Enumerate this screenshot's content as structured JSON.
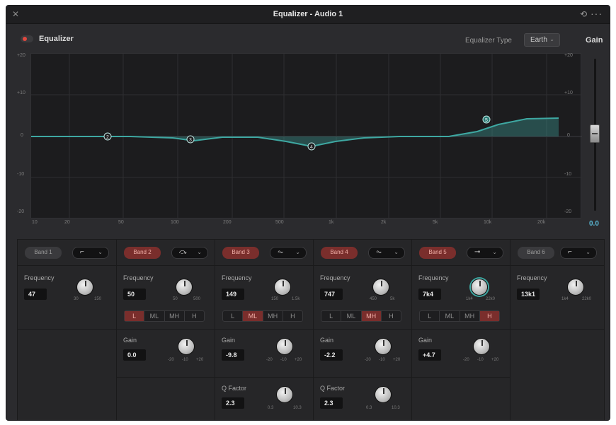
{
  "window": {
    "title": "Equalizer - Audio 1"
  },
  "titlebar": {
    "close_icon": "close-icon",
    "reset_icon": "reset-icon",
    "more_icon": "more-icon",
    "close_glyph": "✕",
    "reset_glyph": "⟲",
    "more_glyph": "···"
  },
  "header": {
    "equalizer_label": "Equalizer",
    "equalizer_enabled": true,
    "type_label": "Equalizer Type",
    "type_value": "Earth",
    "gain_title": "Gain"
  },
  "graph": {
    "left_ticks": [
      "+20",
      "+10",
      "0",
      "-10",
      "-20"
    ],
    "right_ticks": [
      "+20",
      "+10",
      "0",
      "-10",
      "-20"
    ],
    "x_ticks": [
      "10",
      "20",
      "50",
      "100",
      "200",
      "500",
      "1k",
      "2k",
      "5k",
      "10k",
      "20k"
    ],
    "curve_color": "#3ea8a2",
    "nodes": [
      "2",
      "3",
      "4",
      "5"
    ]
  },
  "gain": {
    "value": "0.0",
    "fader_level": 0.5
  },
  "bands": [
    {
      "label": "Band 1",
      "active": false,
      "shape_glyph": "⌐",
      "frequency_label": "Frequency",
      "frequency": "47",
      "freq_min": "30",
      "freq_max": "150"
    },
    {
      "label": "Band 2",
      "active": true,
      "shape_glyph": "⤼",
      "frequency_label": "Frequency",
      "frequency": "50",
      "freq_min": "50",
      "freq_max": "500",
      "ranges": [
        "L",
        "ML",
        "MH",
        "H"
      ],
      "range_selected": "L",
      "gain_label": "Gain",
      "gain": "0.0",
      "gain_min": "-20",
      "gain_mid": "-10",
      "gain_max": "+20"
    },
    {
      "label": "Band 3",
      "active": true,
      "shape_glyph": "⏦",
      "frequency_label": "Frequency",
      "frequency": "149",
      "freq_min": "150",
      "freq_max": "1.5k",
      "ranges": [
        "L",
        "ML",
        "MH",
        "H"
      ],
      "range_selected": "ML",
      "gain_label": "Gain",
      "gain": "-9.8",
      "gain_min": "-20",
      "gain_mid": "-10",
      "gain_max": "+20",
      "q_label": "Q Factor",
      "q": "2.3",
      "q_min": "0.3",
      "q_max": "10.3"
    },
    {
      "label": "Band 4",
      "active": true,
      "shape_glyph": "⏦",
      "frequency_label": "Frequency",
      "frequency": "747",
      "freq_min": "450",
      "freq_max": "5k",
      "ranges": [
        "L",
        "ML",
        "MH",
        "H"
      ],
      "range_selected": "MH",
      "gain_label": "Gain",
      "gain": "-2.2",
      "gain_min": "-20",
      "gain_mid": "-10",
      "gain_max": "+20",
      "q_label": "Q Factor",
      "q": "2.3",
      "q_min": "0.3",
      "q_max": "10.3"
    },
    {
      "label": "Band 5",
      "active": true,
      "shape_glyph": "⊸",
      "frequency_label": "Frequency",
      "frequency": "7k4",
      "freq_min": "1k4",
      "freq_max": "22k0",
      "ranges": [
        "L",
        "ML",
        "MH",
        "H"
      ],
      "range_selected": "H",
      "gain_label": "Gain",
      "gain": "+4.7",
      "gain_min": "-20",
      "gain_mid": "-10",
      "gain_max": "+20"
    },
    {
      "label": "Band 6",
      "active": false,
      "shape_glyph": "⌐",
      "frequency_label": "Frequency",
      "frequency": "13k1",
      "freq_min": "1k4",
      "freq_max": "22k0"
    }
  ]
}
